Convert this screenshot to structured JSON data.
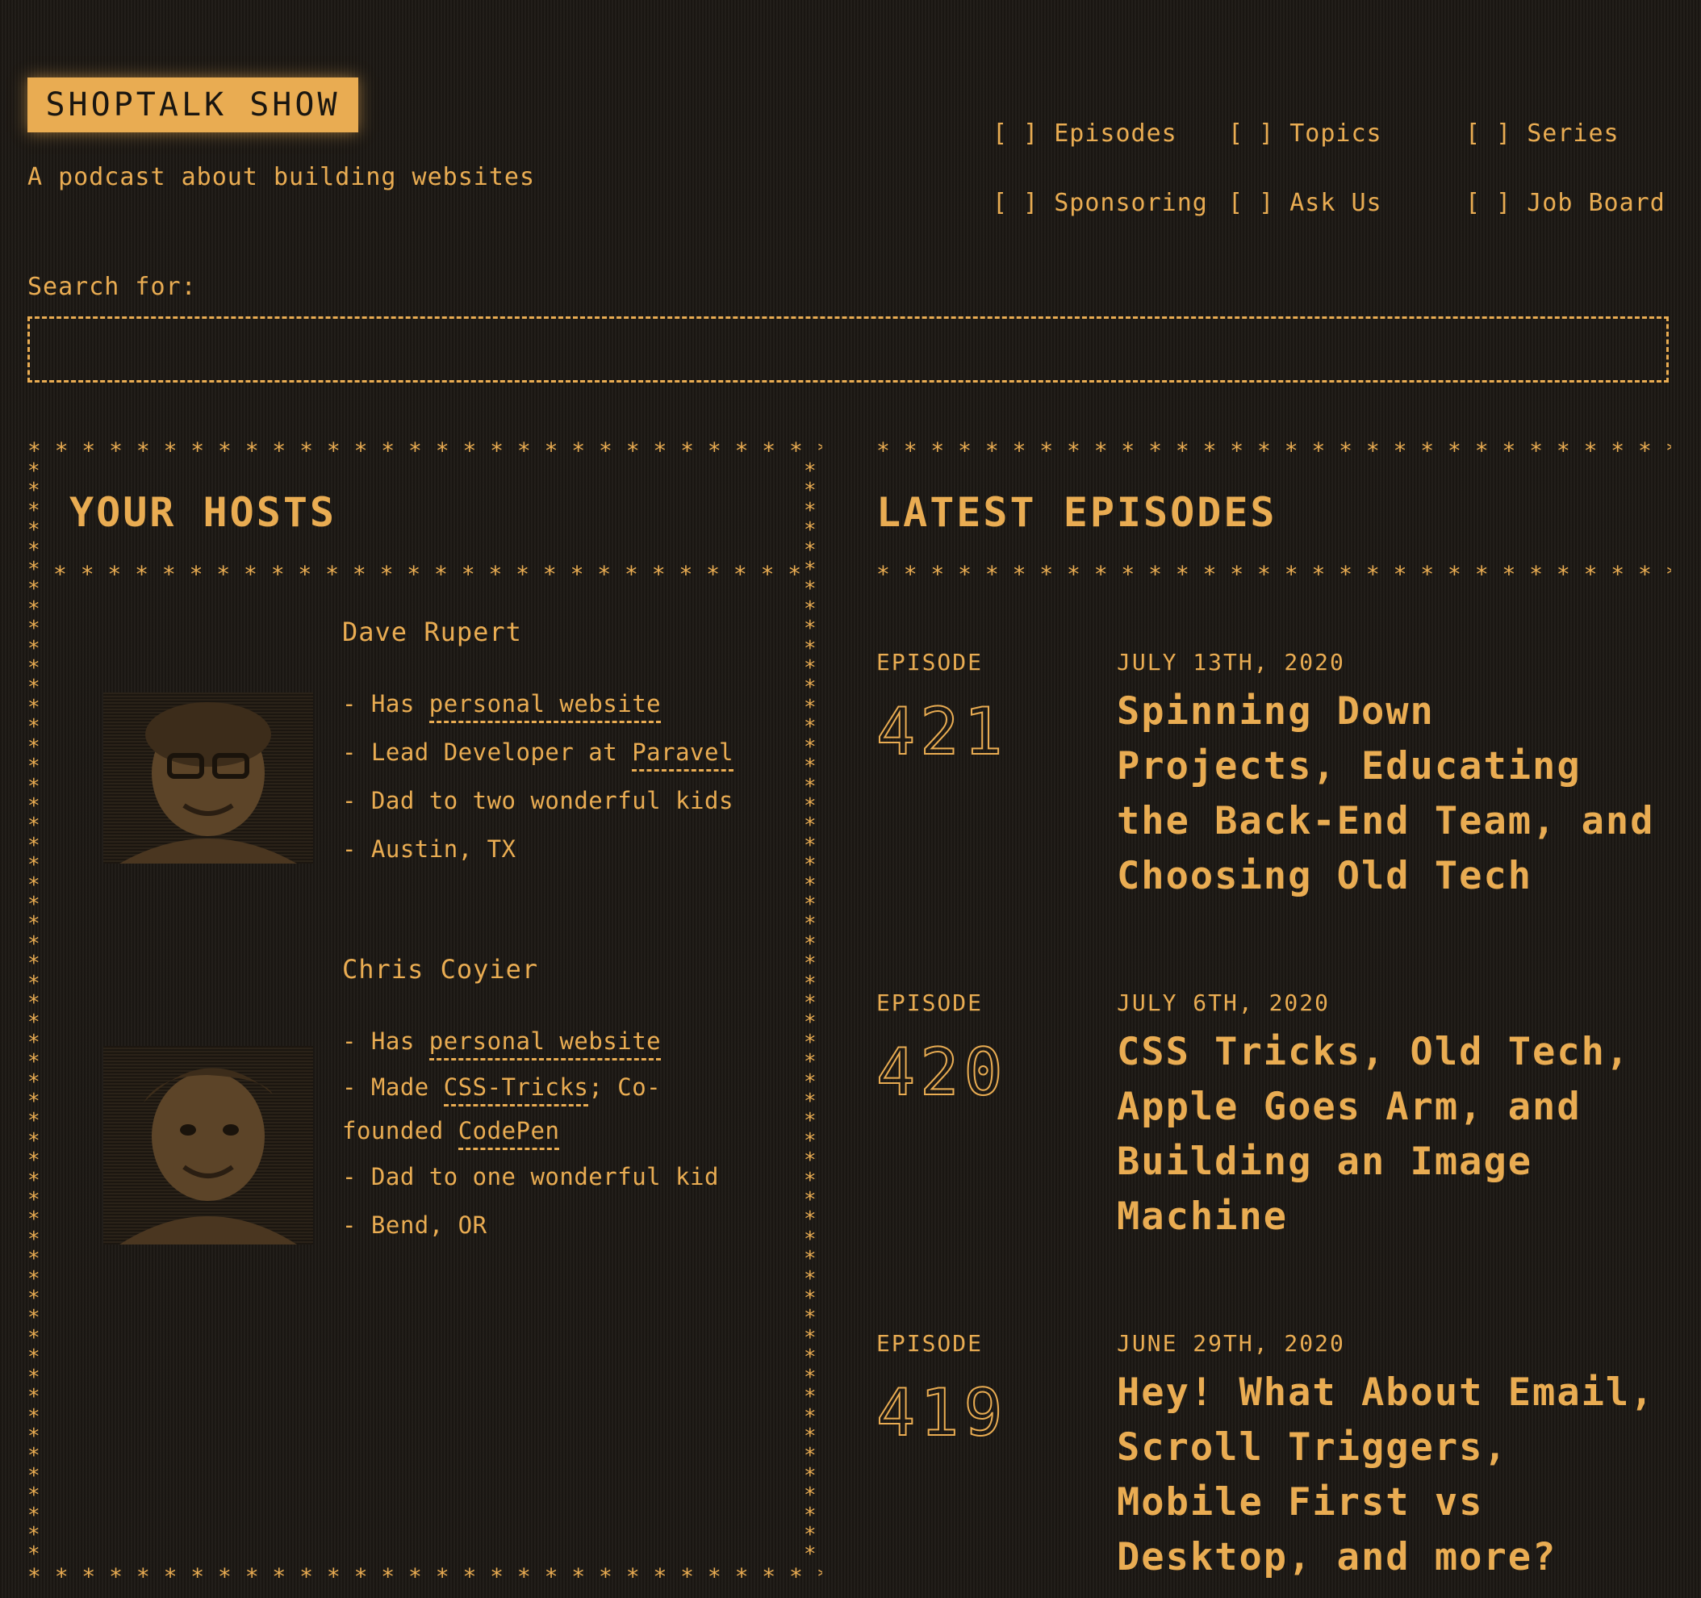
{
  "site": {
    "logo": "SHOPTALK SHOW",
    "tagline": "A podcast about building websites"
  },
  "nav": {
    "bracket": "[ ]",
    "items": [
      "Episodes",
      "Topics",
      "Series",
      "Sponsoring",
      "Ask Us",
      "Job Board"
    ]
  },
  "search": {
    "label": "Search for:",
    "value": ""
  },
  "hosts": {
    "title": "YOUR HOSTS",
    "people": [
      {
        "name": "Dave Rupert",
        "facts": {
          "f1_prefix": "- Has ",
          "f1_link": "personal website",
          "f2_prefix": "- Lead Developer at ",
          "f2_link": "Paravel",
          "f3": "- Dad to two wonderful kids",
          "f4": "- Austin, TX"
        }
      },
      {
        "name": "Chris Coyier",
        "facts": {
          "f1_prefix": "- Has ",
          "f1_link": "personal website",
          "f2_prefix": "- Made ",
          "f2_link": "CSS-Tricks",
          "f2_mid": "; Co-",
          "f2b_prefix": "founded ",
          "f2b_link": "CodePen",
          "f3": "- Dad to one wonderful kid",
          "f4": "- Bend, OR"
        }
      }
    ]
  },
  "episodes": {
    "title": "LATEST EPISODES",
    "label": "EPISODE",
    "items": [
      {
        "number": "421",
        "date": "JULY 13TH, 2020",
        "title": "Spinning Down Projects, Educating the Back-End Team, and Choosing Old Tech"
      },
      {
        "number": "420",
        "date": "JULY 6TH, 2020",
        "title": "CSS Tricks, Old Tech, Apple Goes Arm, and Building an Image Machine"
      },
      {
        "number": "419",
        "date": "JUNE 29TH, 2020",
        "title": "Hey! What About Email, Scroll Triggers, Mobile First vs Desktop, and more?"
      }
    ]
  },
  "colors": {
    "accent": "#e9ac52",
    "background": "#1f1b16"
  }
}
